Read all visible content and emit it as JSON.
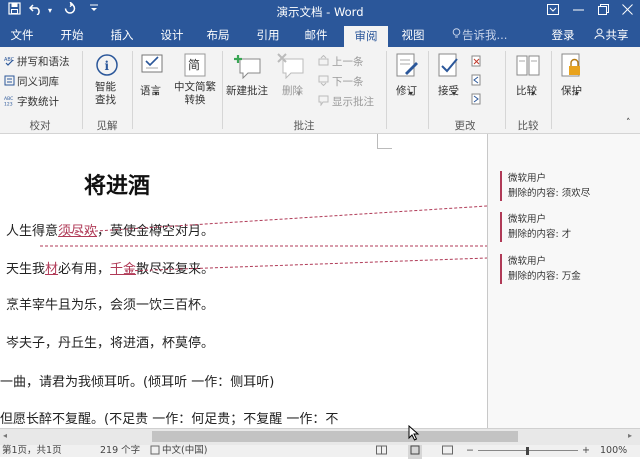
{
  "titlebar": {
    "doc_title": "演示文档 - Word",
    "undo_icon": "undo-icon",
    "redo_icon": "redo-icon",
    "more_icon": "quick-access-more-icon",
    "save_icon": "save-icon"
  },
  "tabs": [
    {
      "label": "文件"
    },
    {
      "label": "开始"
    },
    {
      "label": "插入"
    },
    {
      "label": "设计"
    },
    {
      "label": "布局"
    },
    {
      "label": "引用"
    },
    {
      "label": "邮件"
    },
    {
      "label": "审阅"
    },
    {
      "label": "视图"
    }
  ],
  "tellme": "告诉我...",
  "signin": "登录",
  "share": "共享",
  "ribbon": {
    "proofing": {
      "spell": "拼写和语法",
      "thesaurus": "同义词库",
      "wordcount": "字数统计",
      "label": "校对"
    },
    "insights": {
      "smart_lookup": "智能查找",
      "label": "见解"
    },
    "language": {
      "lang": "语言",
      "convert": "中文简繁转换"
    },
    "comments": {
      "new": "新建批注",
      "delete": "删除",
      "prev": "上一条",
      "next": "下一条",
      "show": "显示批注",
      "label": "批注"
    },
    "tracking": {
      "track": "修订"
    },
    "changes": {
      "accept": "接受",
      "label": "更改"
    },
    "compare": {
      "compare": "比较",
      "label": "比较"
    },
    "protect": {
      "protect": "保护"
    }
  },
  "doc": {
    "title": "将进酒",
    "lines": [
      {
        "pre": "人生得意",
        "mark": "须尽欢",
        "post": "，莫使金樽空对月。"
      },
      {
        "pre": "天生我",
        "mark": "材",
        "mid": "必有用，",
        "mark2": "千金",
        "post": "散尽还复来。"
      },
      {
        "pre": "烹羊宰牛且为乐，会须一饮三百杯。"
      },
      {
        "pre": "岑夫子，丹丘生，将进酒，杯莫停。"
      },
      {
        "pre": "一曲，请君为我倾耳听。(倾耳听  一作：侧耳听)"
      },
      {
        "pre": "但愿长醉不复醒。(不足贵  一作：何足贵；不复醒  一作：不"
      }
    ]
  },
  "comments": [
    {
      "author": "微软用户",
      "text": "删除的内容: 须欢尽"
    },
    {
      "author": "微软用户",
      "text": "删除的内容: 才"
    },
    {
      "author": "微软用户",
      "text": "删除的内容: 万金"
    }
  ],
  "status": {
    "page": "第1页，共1页",
    "words": "219 个字",
    "lang": "中文(中国)",
    "zoom": "100%"
  }
}
